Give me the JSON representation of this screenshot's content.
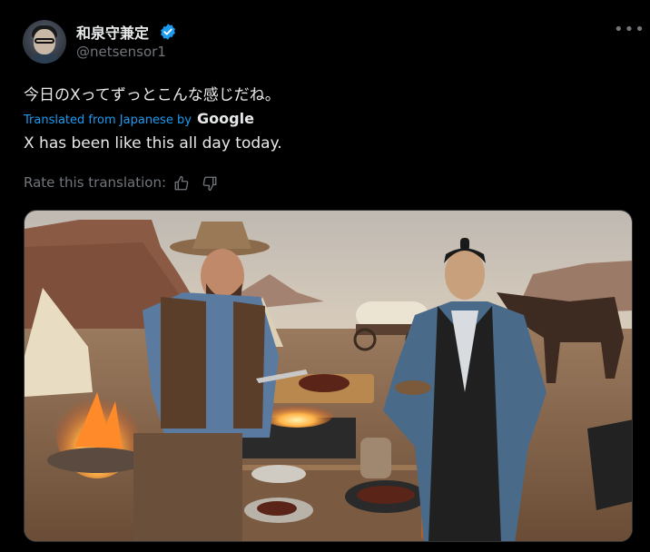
{
  "author": {
    "name": "和泉守兼定",
    "handle": "@netsensor1"
  },
  "post": {
    "original_text": "今日のXってずっとこんな感じだね。",
    "translated_from": "Translated from Japanese by",
    "translator": "Google",
    "translated_text": "X has been like this all day today.",
    "rate_label": "Rate this translation:"
  },
  "colors": {
    "accent": "#1d9bf0",
    "muted": "#71767b",
    "text": "#e7e9ea",
    "background": "#000000"
  },
  "icons": [
    "verified-badge-icon",
    "more-options-icon",
    "thumbs-up-icon",
    "thumbs-down-icon"
  ]
}
